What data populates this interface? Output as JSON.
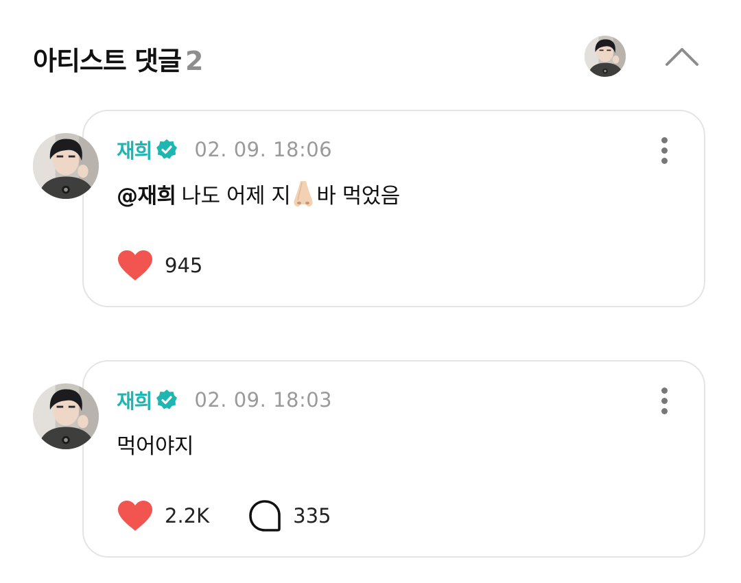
{
  "header": {
    "title": "아티스트 댓글",
    "count": "2"
  },
  "comments": [
    {
      "author": "재희",
      "timestamp": "02. 09. 18:06",
      "mention": "@재희",
      "text_before": "나도 어제 지",
      "text_after": "바 먹었음",
      "emoji": "nose-emoji",
      "likes": "945"
    },
    {
      "author": "재희",
      "timestamp": "02. 09. 18:03",
      "text": "먹어야지",
      "likes": "2.2K",
      "replies": "335"
    }
  ],
  "colors": {
    "accent": "#1fb5b0",
    "heart": "#f2544f",
    "muted": "#9a9a9a",
    "card_border": "#e4e4e4"
  },
  "icons": {
    "verified": "verified-badge-icon",
    "like": "heart-icon",
    "reply": "speech-bubble-icon",
    "more": "more-vertical-icon",
    "collapse": "chevron-up-icon"
  }
}
